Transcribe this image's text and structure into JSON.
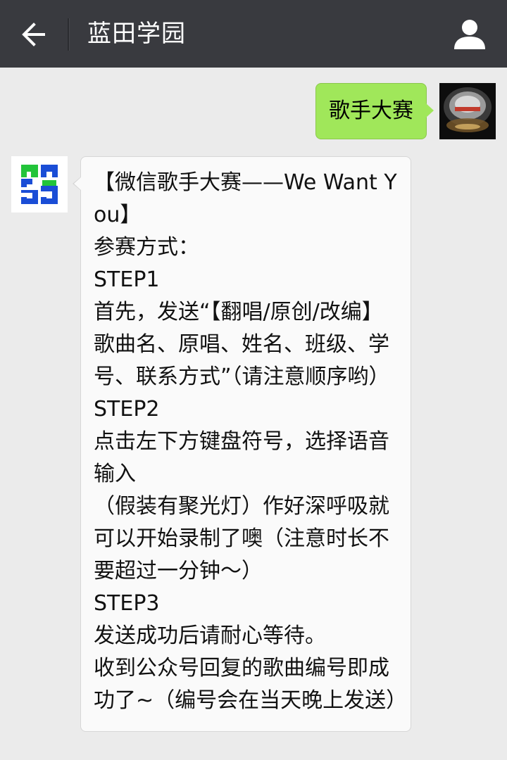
{
  "header": {
    "title": "蓝田学园",
    "back_icon": "arrow-left-icon",
    "profile_icon": "person-icon",
    "background": "#393a3f"
  },
  "messages": {
    "outgoing": {
      "text": "歌手大赛",
      "bubble_color": "#a0e75a",
      "avatar": "user-avatar"
    },
    "incoming": {
      "avatar": "official-account-logo",
      "lines": [
        "【微信歌手大赛——We Want You】",
        "参赛方式：",
        "STEP1",
        "首先，发送“【翻唱/原创/改编】歌曲名、原唱、姓名、班级、学号、联系方式”（请注意顺序哟）",
        "STEP2",
        "点击左下方键盘符号，选择语音输入",
        "（假装有聚光灯）作好深呼吸就可以开始录制了噢（注意时长不要超过一分钟～）",
        "STEP3",
        "发送成功后请耐心等待。",
        "收到公众号回复的歌曲编号即成功了~（编号会在当天晚上发送）"
      ]
    }
  }
}
